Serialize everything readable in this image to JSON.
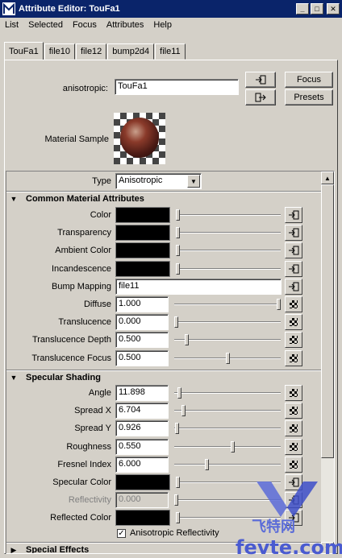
{
  "window": {
    "title": "Attribute Editor: TouFa1"
  },
  "menu": [
    "List",
    "Selected",
    "Focus",
    "Attributes",
    "Help"
  ],
  "tabs": [
    "TouFa1",
    "file10",
    "file12",
    "bump2d4",
    "file11"
  ],
  "node": {
    "label": "anisotropic:",
    "name": "TouFa1",
    "focus_label": "Focus",
    "presets_label": "Presets",
    "material_sample_label": "Material Sample"
  },
  "type_row": {
    "label": "Type",
    "value": "Anisotropic"
  },
  "sections": {
    "common": "Common Material Attributes",
    "specular": "Specular Shading",
    "special": "Special Effects"
  },
  "common_attrs": [
    {
      "label": "Color",
      "kind": "color"
    },
    {
      "label": "Transparency",
      "kind": "color"
    },
    {
      "label": "Ambient Color",
      "kind": "color"
    },
    {
      "label": "Incandescence",
      "kind": "color"
    },
    {
      "label": "Bump Mapping",
      "kind": "text",
      "value": "file11"
    },
    {
      "label": "Diffuse",
      "kind": "num",
      "value": "1.000",
      "level": 1.0
    },
    {
      "label": "Translucence",
      "kind": "num",
      "value": "0.000",
      "level": 0.0
    },
    {
      "label": "Translucence Depth",
      "kind": "num",
      "value": "0.500",
      "level": 0.1
    },
    {
      "label": "Translucence Focus",
      "kind": "num",
      "value": "0.500",
      "level": 0.5
    }
  ],
  "specular_attrs": [
    {
      "label": "Angle",
      "kind": "num",
      "value": "11.898",
      "level": 0.03
    },
    {
      "label": "Spread X",
      "kind": "num",
      "value": "6.704",
      "level": 0.07
    },
    {
      "label": "Spread Y",
      "kind": "num",
      "value": "0.926",
      "level": 0.01
    },
    {
      "label": "Roughness",
      "kind": "num",
      "value": "0.550",
      "level": 0.55
    },
    {
      "label": "Fresnel Index",
      "kind": "num",
      "value": "6.000",
      "level": 0.3
    },
    {
      "label": "Specular Color",
      "kind": "color"
    },
    {
      "label": "Reflectivity",
      "kind": "num",
      "value": "0.000",
      "level": 0.0,
      "disabled": true
    },
    {
      "label": "Reflected Color",
      "kind": "color"
    }
  ],
  "anisotropic_reflectivity": {
    "label": "Anisotropic Reflectivity",
    "checked": true
  },
  "watermark": {
    "text1": "飞特网",
    "text2": "fevte.com"
  },
  "colors": {
    "titlebar": "#0a246a",
    "panel": "#d4d0c8",
    "watermark": "#5a6bd8"
  }
}
